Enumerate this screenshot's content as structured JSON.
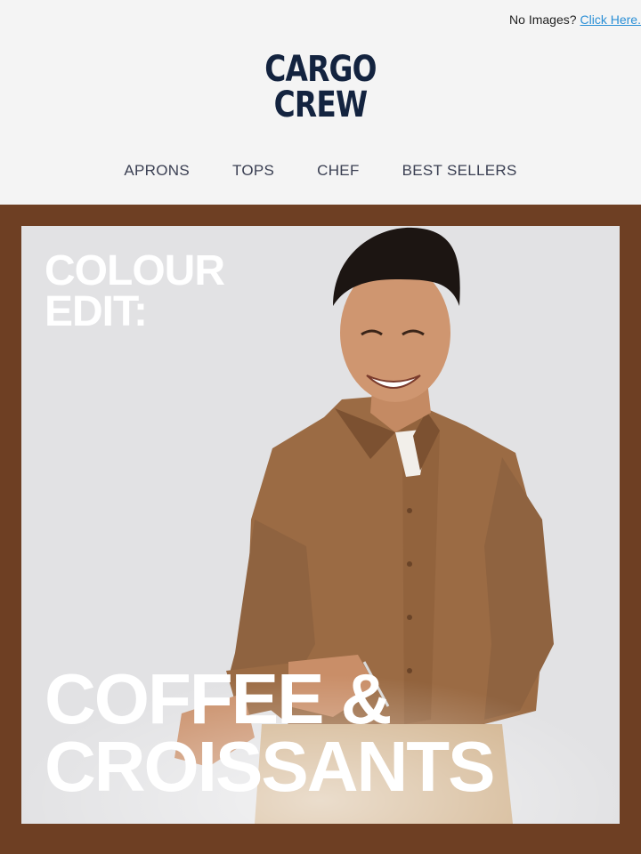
{
  "topbar": {
    "prompt": "No Images?",
    "link": "Click Here."
  },
  "logo": {
    "line1": "CARGO",
    "line2": "CREW"
  },
  "nav": [
    "APRONS",
    "TOPS",
    "CHEF",
    "BEST SELLERS"
  ],
  "hero": {
    "kicker_line1": "COLOUR",
    "kicker_line2": "EDIT:",
    "headline_line1": "COFFEE &",
    "headline_line2": "CROISSANTS"
  },
  "colors": {
    "frame": "#6e3f23",
    "logo": "#13233f",
    "link": "#2a8fd6",
    "shirt": "#9b6b44"
  }
}
